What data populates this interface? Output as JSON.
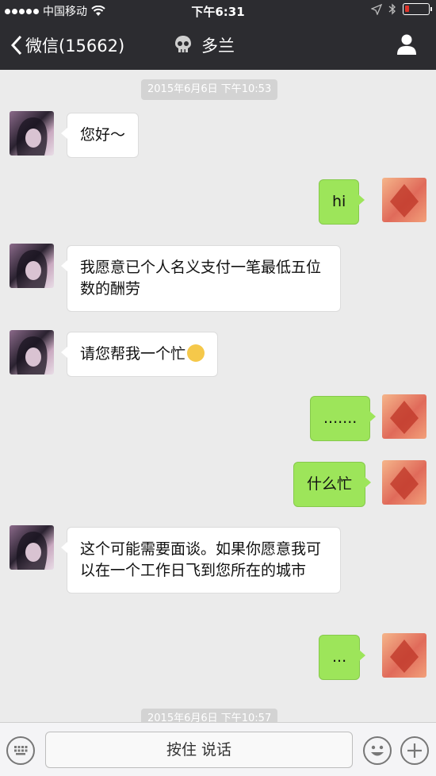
{
  "status": {
    "carrier": "中国移动",
    "time": "下午6:31"
  },
  "nav": {
    "back_label": "微信(15662)",
    "title": "多兰"
  },
  "colors": {
    "nav_bg": "#2c2c30",
    "chat_bg": "#ebebeb",
    "outgoing_bubble": "#9de55a",
    "incoming_bubble": "#ffffff",
    "battery_low": "#e0352b"
  },
  "timestamps": [
    "2015年6月6日 下午10:53",
    "2015年6月6日 下午10:57"
  ],
  "messages": [
    {
      "from": "them",
      "text": "您好～"
    },
    {
      "from": "me",
      "text": "hi"
    },
    {
      "from": "them",
      "text": "我愿意已个人名义支付一笔最低五位数的酬劳"
    },
    {
      "from": "them",
      "text": "请您帮我一个忙"
    },
    {
      "from": "me",
      "text": "......."
    },
    {
      "from": "me",
      "text": "什么忙"
    },
    {
      "from": "them",
      "text": "这个可能需要面谈。如果你愿意我可以在一个工作日飞到您所在的城市"
    },
    {
      "from": "me",
      "text": "..."
    }
  ],
  "input": {
    "hold_to_talk": "按住 说话"
  },
  "icons": [
    "wifi-icon",
    "location-arrow-icon",
    "bluetooth-icon",
    "battery-icon",
    "back-chevron-icon",
    "skull-icon",
    "person-icon",
    "keyboard-icon",
    "emoji-icon",
    "plus-icon",
    "wink-emoji-icon"
  ]
}
